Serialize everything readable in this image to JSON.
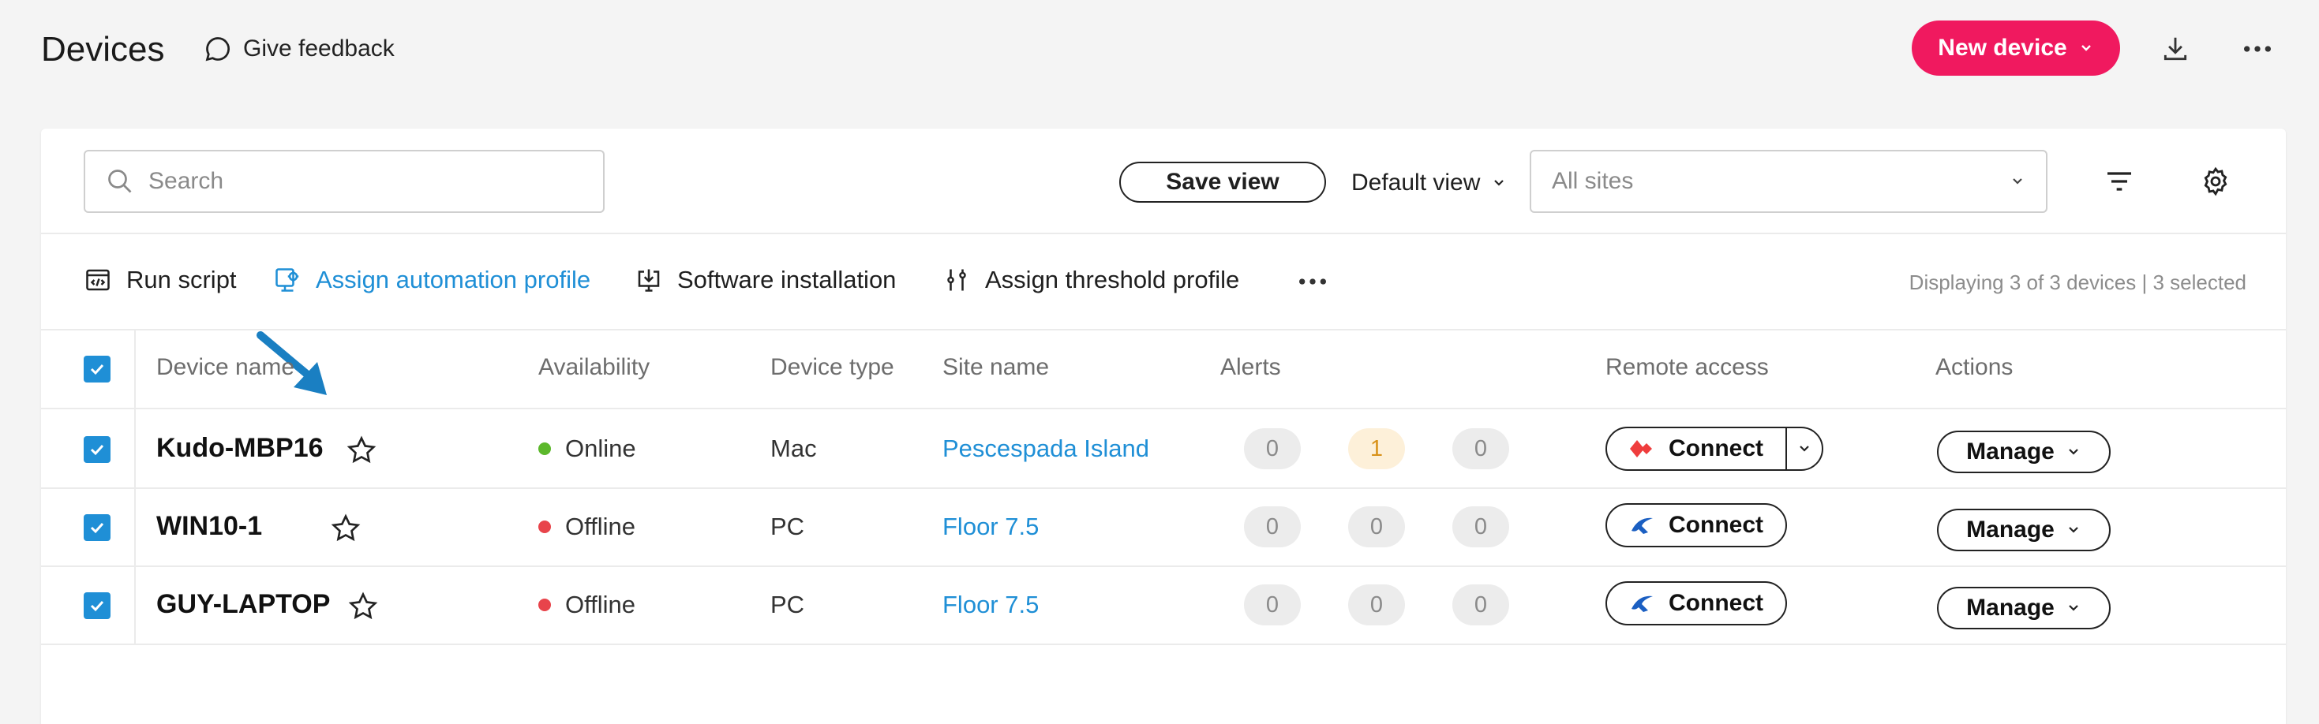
{
  "header": {
    "title": "Devices",
    "feedback_label": "Give feedback",
    "new_device_label": "New device",
    "accent_color": "#f0195f"
  },
  "filters": {
    "search_placeholder": "Search",
    "save_view_label": "Save view",
    "view_selected": "Default view",
    "sites_placeholder": "All sites"
  },
  "actions": {
    "run_script": "Run script",
    "assign_automation_profile": "Assign automation profile",
    "software_installation": "Software installation",
    "assign_threshold_profile": "Assign threshold profile",
    "displaying": "Displaying 3 of 3 devices | 3 selected"
  },
  "table": {
    "columns": {
      "device_name": "Device name",
      "availability": "Availability",
      "device_type": "Device type",
      "site_name": "Site name",
      "alerts": "Alerts",
      "remote_access": "Remote access",
      "actions": "Actions"
    },
    "rows": [
      {
        "name": "Kudo-MBP16",
        "status": "Online",
        "status_color": "#5cb82c",
        "type": "Mac",
        "site": "Pescespada Island",
        "alerts": [
          "0",
          "1",
          "0"
        ],
        "connect_label": "Connect",
        "connect_icon": "anydesk-icon",
        "manage_label": "Manage"
      },
      {
        "name": "WIN10-1",
        "status": "Offline",
        "status_color": "#e8444b",
        "type": "PC",
        "site": "Floor 7.5",
        "alerts": [
          "0",
          "0",
          "0"
        ],
        "connect_label": "Connect",
        "connect_icon": "splashtop-icon",
        "manage_label": "Manage"
      },
      {
        "name": "GUY-LAPTOP",
        "status": "Offline",
        "status_color": "#e8444b",
        "type": "PC",
        "site": "Floor 7.5",
        "alerts": [
          "0",
          "0",
          "0"
        ],
        "connect_label": "Connect",
        "connect_icon": "splashtop-icon",
        "manage_label": "Manage"
      }
    ]
  },
  "link_color": "#1f8fd6"
}
